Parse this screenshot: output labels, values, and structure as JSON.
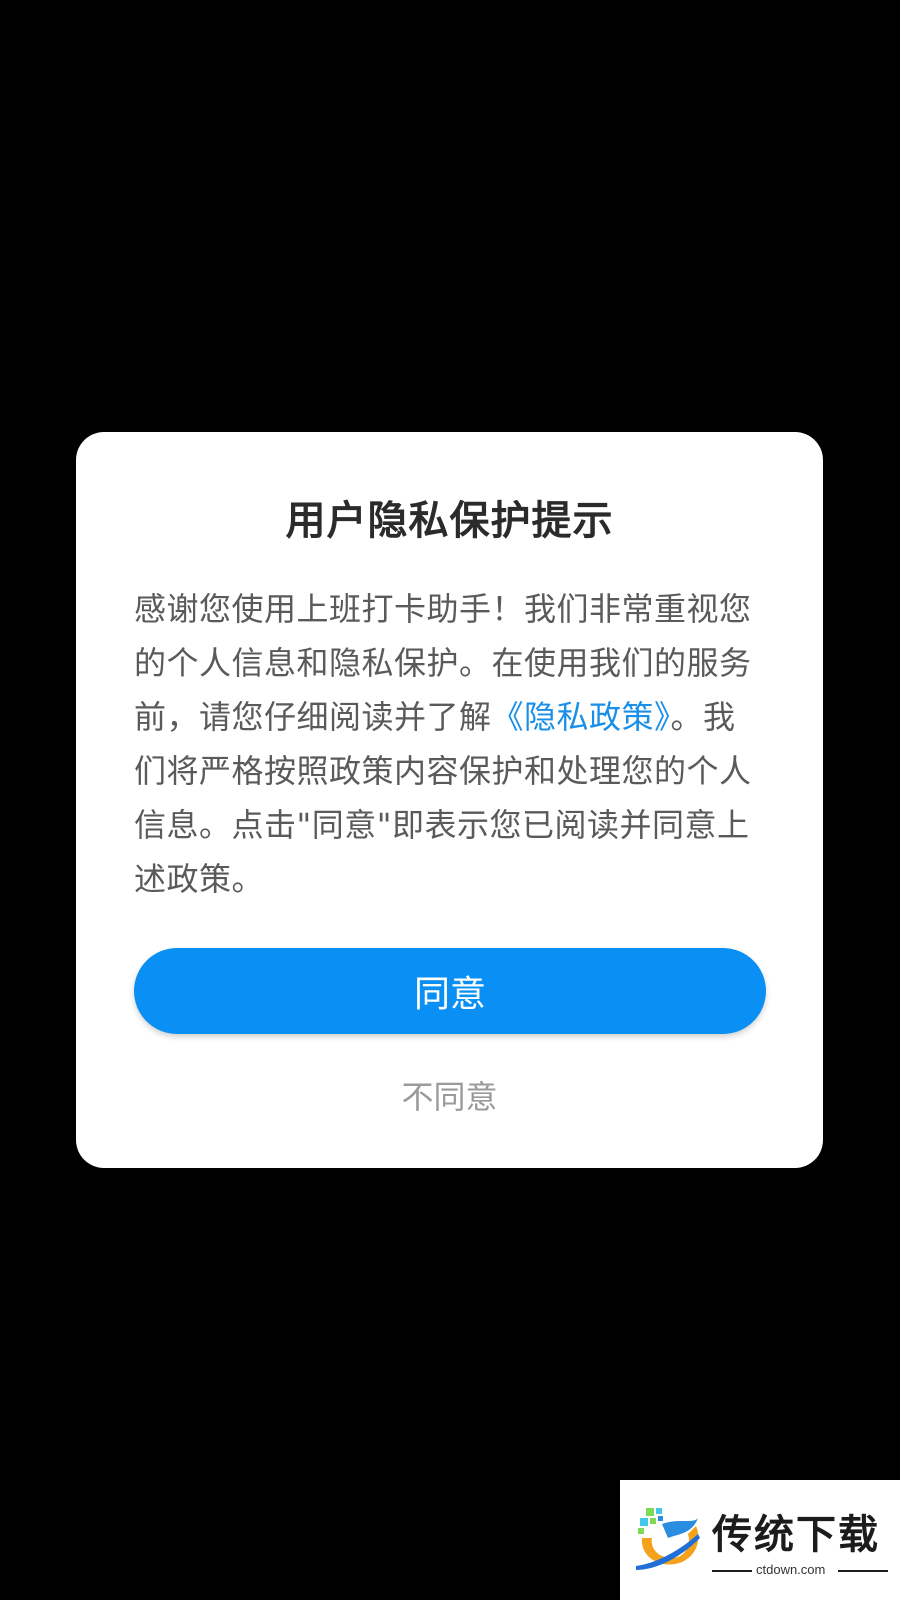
{
  "dialog": {
    "title": "用户隐私保护提示",
    "body_part1": "感谢您使用上班打卡助手！我们非常重视您的个人信息和隐私保护。在使用我们的服务前，请您仔细阅读并了解",
    "policy_link": "《隐私政策》",
    "body_part2": "。我们将严格按照政策内容保护和处理您的个人信息。点击\"同意\"即表示您已阅读并同意上述政策。",
    "agree_label": "同意",
    "disagree_label": "不同意"
  },
  "watermark": {
    "brand": "传统下载",
    "domain": "ctdown.com"
  },
  "colors": {
    "accent": "#0a90f5",
    "link": "#1a8fe8",
    "background": "#000000"
  }
}
